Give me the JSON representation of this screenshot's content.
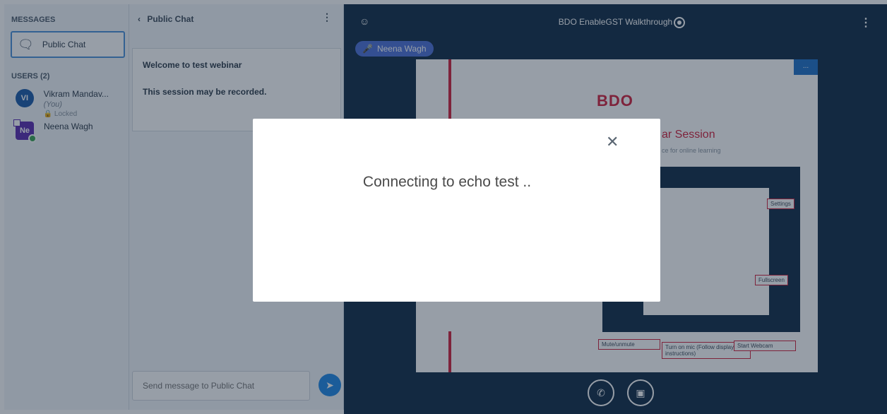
{
  "sidebar": {
    "messages_title": "MESSAGES",
    "chat_item_label": "Public Chat",
    "users_title": "USERS (2)",
    "users": [
      {
        "initials": "VI",
        "name": "Vikram Mandav...",
        "you": "(You)",
        "status": "Locked"
      },
      {
        "initials": "Ne",
        "name": "Neena Wagh",
        "status": ""
      }
    ]
  },
  "chat": {
    "header": "Public Chat",
    "welcome_line1": "Welcome to test webinar",
    "welcome_line2": "This session may be recorded.",
    "input_placeholder": "Send message to Public Chat"
  },
  "main": {
    "title": "BDO EnableGST Walkthrough",
    "talker_name": "Neena Wagh",
    "slide": {
      "logo": "BDO",
      "session_title": "ar Session",
      "session_sub": "ce for online learning",
      "top_button": "..."
    },
    "annotations": {
      "settings": "Settings",
      "fullscreen": "Fullscreen",
      "mute": "Mute/unmute",
      "mic": "Turn on mic (Follow display instructions)",
      "webcam": "Start Webcam"
    }
  },
  "modal": {
    "message": "Connecting to echo test .."
  },
  "colors": {
    "accent": "#1e88e5",
    "dark_bg": "#0f2a45",
    "brand_red": "#d11f3b"
  }
}
